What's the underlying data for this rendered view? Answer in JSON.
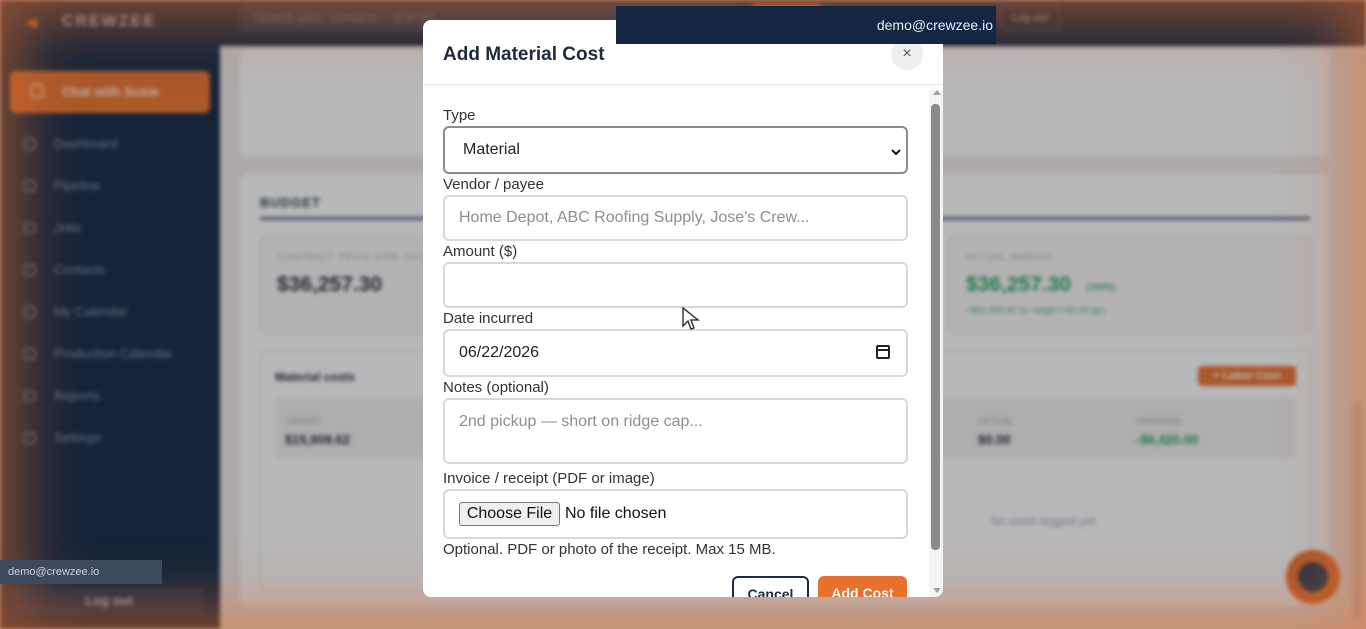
{
  "app": {
    "brand": "CREWZEE",
    "search_placeholder": "Search jobs, contacts... (Ctrl K)",
    "top_logout": "Log out",
    "user_email": "demo@crewzee.io"
  },
  "sidebar": {
    "chat_button": "Chat with Susie",
    "items": [
      {
        "label": "Dashboard"
      },
      {
        "label": "Pipeline"
      },
      {
        "label": "Jobs"
      },
      {
        "label": "Contacts"
      },
      {
        "label": "My Calendar"
      },
      {
        "label": "Production Calendar"
      },
      {
        "label": "Reports"
      },
      {
        "label": "Settings"
      }
    ],
    "email": "demo@crewzee.io",
    "logout": "Log out"
  },
  "budget": {
    "title": "BUDGET",
    "contract_label": "CONTRACT PRICE (PRE-TAX)",
    "contract_value": "$36,257.30",
    "margin_label": "ACTUAL MARGIN",
    "margin_value": "$36,257.30",
    "margin_pct": "(100%)",
    "margin_sub": "+$22,329.62 vs. target (+61.59 pp)",
    "material_title": "Material costs",
    "labor_button": "+ Labor Cost",
    "target_label": "TARGET",
    "target_value": "$15,909.62",
    "actual_label": "ACTUAL",
    "actual_value": "$0.00",
    "variance_label": "VARIANCE",
    "variance_value": "-$6,420.00",
    "empty_text": "No costs logged yet"
  },
  "modal": {
    "title": "Add Material Cost",
    "close": "×",
    "type_label": "Type",
    "type_value": "Material",
    "vendor_label": "Vendor / payee",
    "vendor_placeholder": "Home Depot, ABC Roofing Supply, Jose's Crew...",
    "amount_label": "Amount ($)",
    "amount_value": "",
    "date_label": "Date incurred",
    "date_value": "06/22/2026",
    "notes_label": "Notes (optional)",
    "notes_placeholder": "2nd pickup — short on ridge cap...",
    "file_label": "Invoice / receipt (PDF or image)",
    "choose_file": "Choose File",
    "no_file": "No file chosen",
    "hint": "Optional. PDF or photo of the receipt. Max 15 MB.",
    "cancel": "Cancel",
    "submit": "Add Cost"
  },
  "colors": {
    "accent": "#e8712d",
    "navy": "#132742",
    "positive": "#1f9e5a"
  }
}
